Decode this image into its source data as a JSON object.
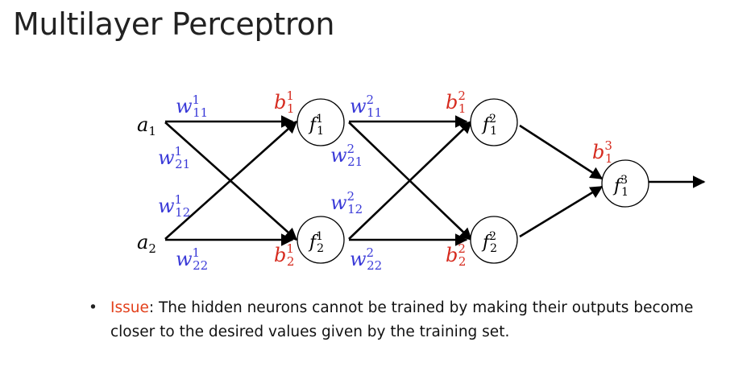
{
  "title": "Multilayer Perceptron",
  "colors": {
    "weight": "#3b3bd8",
    "bias": "#d62b1f",
    "issue": "#e3401b",
    "arrow": "#000000",
    "node_stroke": "#000000"
  },
  "inputs": [
    {
      "base": "a",
      "sub": "1"
    },
    {
      "base": "a",
      "sub": "2"
    }
  ],
  "nodes": [
    {
      "base": "f",
      "sup": "1",
      "sub": "1"
    },
    {
      "base": "f",
      "sup": "1",
      "sub": "2"
    },
    {
      "base": "f",
      "sup": "2",
      "sub": "1"
    },
    {
      "base": "f",
      "sup": "2",
      "sub": "2"
    },
    {
      "base": "f",
      "sup": "3",
      "sub": "1"
    }
  ],
  "weights": [
    {
      "base": "w",
      "sup": "1",
      "sub": "11"
    },
    {
      "base": "w",
      "sup": "1",
      "sub": "21"
    },
    {
      "base": "w",
      "sup": "1",
      "sub": "12"
    },
    {
      "base": "w",
      "sup": "1",
      "sub": "22"
    },
    {
      "base": "w",
      "sup": "2",
      "sub": "11"
    },
    {
      "base": "w",
      "sup": "2",
      "sub": "21"
    },
    {
      "base": "w",
      "sup": "2",
      "sub": "12"
    },
    {
      "base": "w",
      "sup": "2",
      "sub": "22"
    }
  ],
  "biases": [
    {
      "base": "b",
      "sup": "1",
      "sub": "1"
    },
    {
      "base": "b",
      "sup": "1",
      "sub": "2"
    },
    {
      "base": "b",
      "sup": "2",
      "sub": "1"
    },
    {
      "base": "b",
      "sup": "2",
      "sub": "2"
    },
    {
      "base": "b",
      "sup": "3",
      "sub": "1"
    }
  ],
  "bullet": {
    "marker": "•",
    "label": "Issue",
    "text": ": The hidden neurons cannot be trained by making their outputs become closer to the desired values given by the training set."
  }
}
